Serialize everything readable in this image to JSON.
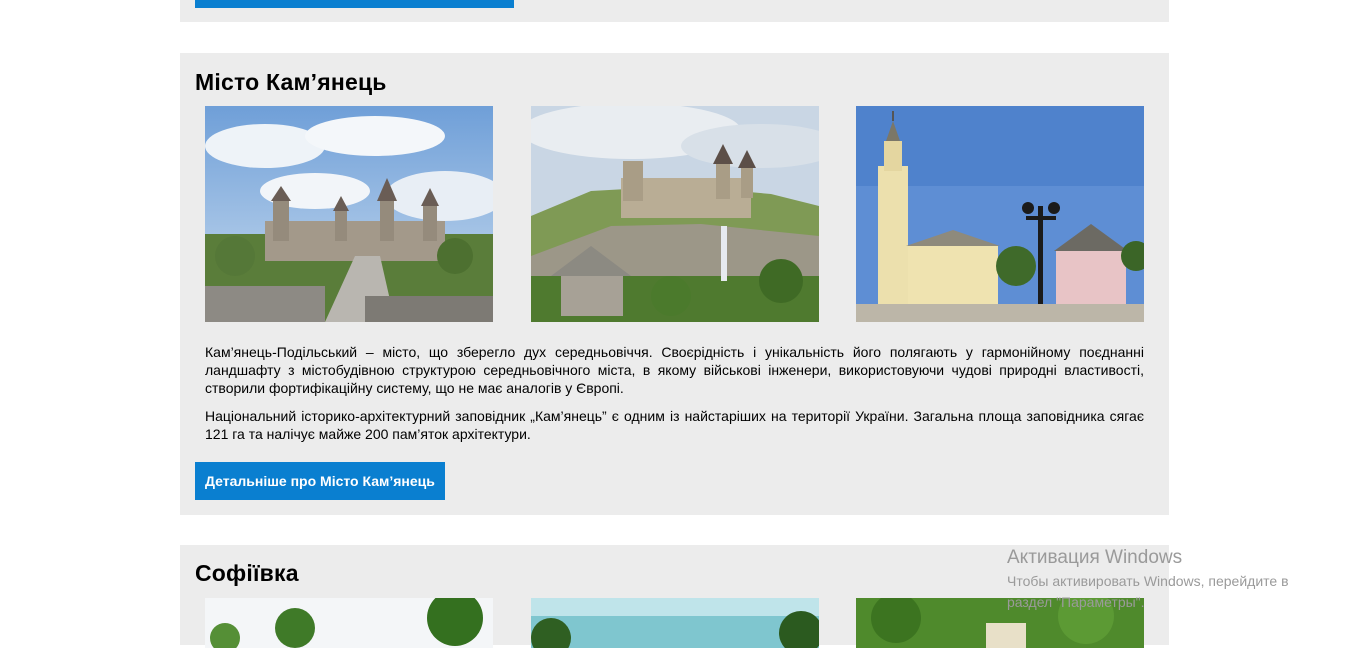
{
  "sections": [
    {
      "title": "Місто Кам’янець",
      "paragraphs": [
        "Кам’янець-Подільський – місто, що зберегло дух середньовіччя. Своєрідність і унікальність його полягають у гармонійному поєднанні ландшафту з містобудівною структурою середньовічного міста, в якому військові інженери, використовуючи чудові природні властивості, створили фортифікаційну систему, що не має аналогів у Європі.",
        "Національний історико-архітектурний заповідник „Кам’янець” є одним із найстаріших на території України. Загальна площа заповідника сягає 121 га та налічує майже 200 пам’яток архітектури."
      ],
      "button_label": "Детальніше про Місто Кам’янець",
      "images": [
        "castle-bridge-photo",
        "castle-hill-photo",
        "town-hall-photo"
      ]
    },
    {
      "title": "Софіївка",
      "images": [
        "park-trees-photo",
        "park-pond-photo",
        "park-pavilion-photo"
      ]
    }
  ],
  "watermark": {
    "title": "Активация Windows",
    "subtitle": "Чтобы активировать Windows, перейдите в раздел \"Параметры\"."
  },
  "colors": {
    "card_bg": "#ececec",
    "button_bg": "#0a7fd0",
    "button_text": "#ffffff"
  }
}
